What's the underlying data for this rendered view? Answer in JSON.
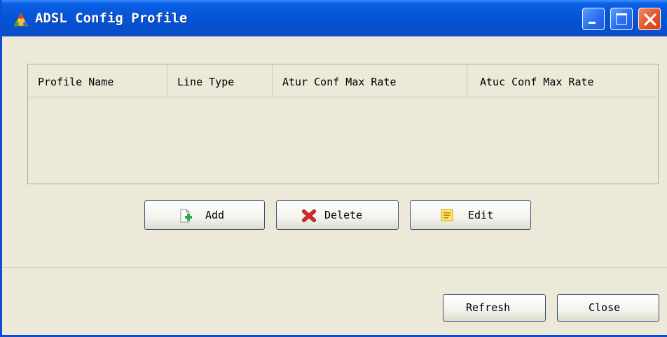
{
  "window": {
    "title": "ADSL Config Profile",
    "icon": "app-triangle-icon",
    "controls": [
      "minimize-icon",
      "maximize-icon",
      "close-icon"
    ]
  },
  "table": {
    "columns": [
      "Profile Name",
      "Line Type",
      "Atur Conf Max Rate",
      "Atuc Conf Max Rate"
    ],
    "rows": []
  },
  "actions": {
    "add_label": "Add",
    "delete_label": "Delete",
    "edit_label": "Edit",
    "add_icon": "add-document-icon",
    "delete_icon": "delete-x-icon",
    "edit_icon": "edit-note-icon"
  },
  "footer": {
    "refresh_label": "Refresh",
    "close_label": "Close"
  },
  "colors": {
    "titlebar": "#0654d8",
    "background": "#ece9d8",
    "close_button": "#e25526"
  }
}
